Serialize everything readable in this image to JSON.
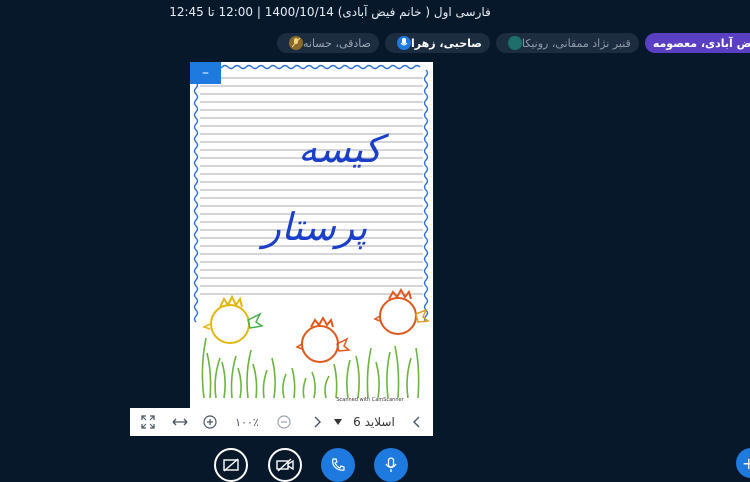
{
  "header": {
    "title": "فارسی اول ( خانم فیض آبادی) 1400/10/14 | 12:00 تا 12:45"
  },
  "participants": [
    {
      "name": "صادقی، حسانه"
    },
    {
      "name": "صاحبی، زهرا"
    },
    {
      "name": "قنبر نژاد ممقانی، رونیکا"
    },
    {
      "name": "فیض آبادی، معصومه"
    }
  ],
  "slide": {
    "handwriting": [
      "کیسه",
      "پرستار"
    ],
    "scanner_note": "Scanned with CamScanner"
  },
  "toolbar": {
    "slide_label": "اسلاید 6",
    "zoom": "۱۰۰٪",
    "minimize_symbol": "–"
  },
  "colors": {
    "accent": "#1f7ae0",
    "background": "#07182a",
    "presenter": "#5b3fc2"
  }
}
